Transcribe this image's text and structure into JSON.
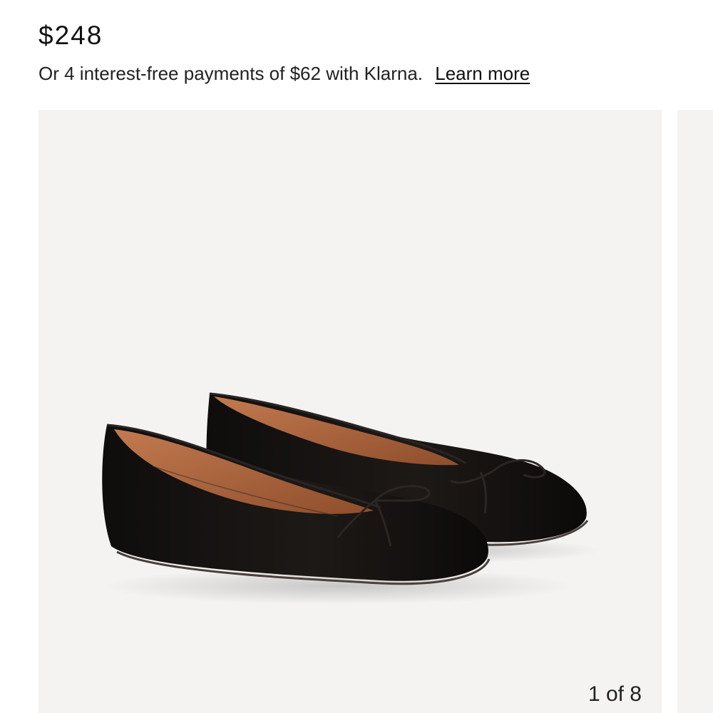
{
  "product": {
    "price": "$248",
    "klarna_text": "Or 4 interest-free payments of $62 with Klarna.",
    "learn_more_label": "Learn more"
  },
  "gallery": {
    "counter": "1 of 8",
    "background_color": "#f4f3f2",
    "current_image": "black-leather-ballet-flats-with-bow"
  },
  "colors": {
    "text": "#111111",
    "shoe_leather": "#161311",
    "shoe_lining": "#a9633f"
  }
}
